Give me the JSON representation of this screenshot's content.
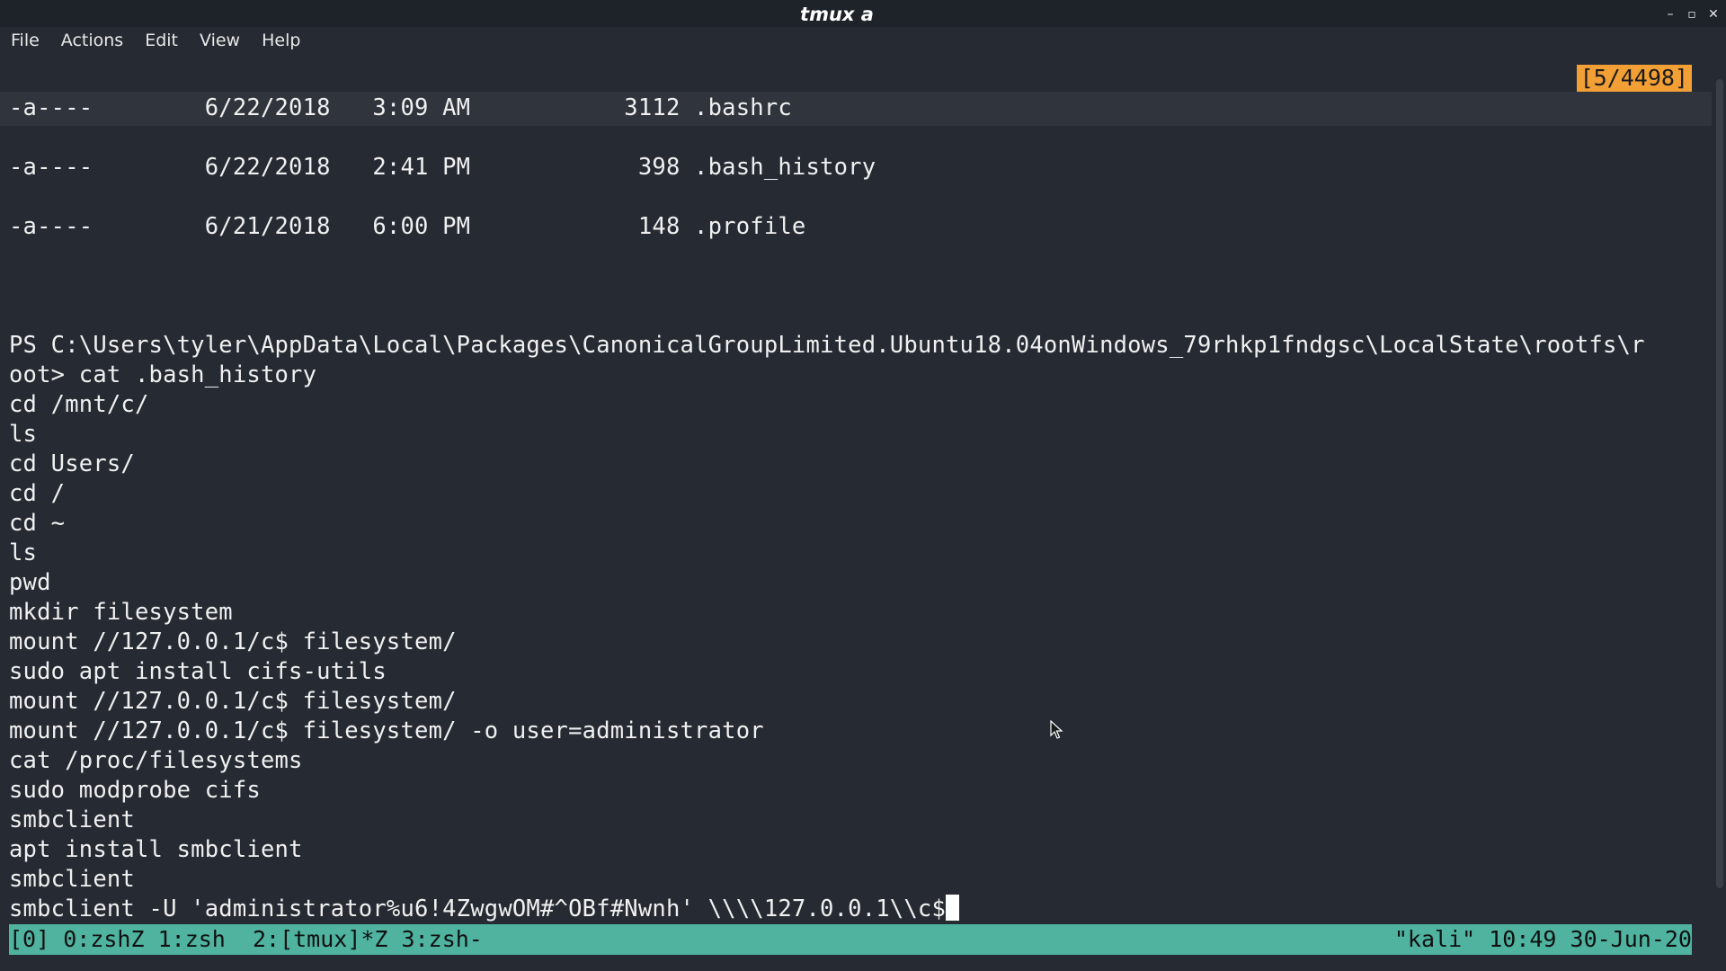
{
  "window": {
    "title": "tmux a"
  },
  "menubar": {
    "items": [
      "File",
      "Actions",
      "Edit",
      "View",
      "Help"
    ]
  },
  "terminal": {
    "copy_mode_indicator": "[5/4498]",
    "lines": [
      "-a----        6/22/2018   3:09 AM           3112 .bashrc",
      "",
      "-a----        6/22/2018   2:41 PM            398 .bash_history",
      "",
      "-a----        6/21/2018   6:00 PM            148 .profile",
      "",
      "",
      "",
      "PS C:\\Users\\tyler\\AppData\\Local\\Packages\\CanonicalGroupLimited.Ubuntu18.04onWindows_79rhkp1fndgsc\\LocalState\\rootfs\\r",
      "oot> cat .bash_history",
      "cd /mnt/c/",
      "ls",
      "cd Users/",
      "cd /",
      "cd ~",
      "ls",
      "pwd",
      "mkdir filesystem",
      "mount //127.0.0.1/c$ filesystem/",
      "sudo apt install cifs-utils",
      "mount //127.0.0.1/c$ filesystem/",
      "mount //127.0.0.1/c$ filesystem/ -o user=administrator",
      "cat /proc/filesystems",
      "sudo modprobe cifs",
      "smbclient",
      "apt install smbclient",
      "smbclient",
      "smbclient -U 'administrator%u6!4ZwgwOM#^OBf#Nwnh' \\\\\\\\127.0.0.1\\\\c$"
    ]
  },
  "statusbar": {
    "session": "[0]",
    "windows": [
      "0:zshZ",
      "1:zsh",
      "2:[tmux]*Z",
      "3:zsh-"
    ],
    "right": "\"kali\" 10:49 30-Jun-20"
  },
  "colors": {
    "terminal_bg": "#262b33",
    "status_bg": "#4fb3a0",
    "indicator_bg": "#f2a036"
  },
  "icons": {
    "minimize": "minimize-icon",
    "maximize": "maximize-icon",
    "close": "close-icon"
  }
}
